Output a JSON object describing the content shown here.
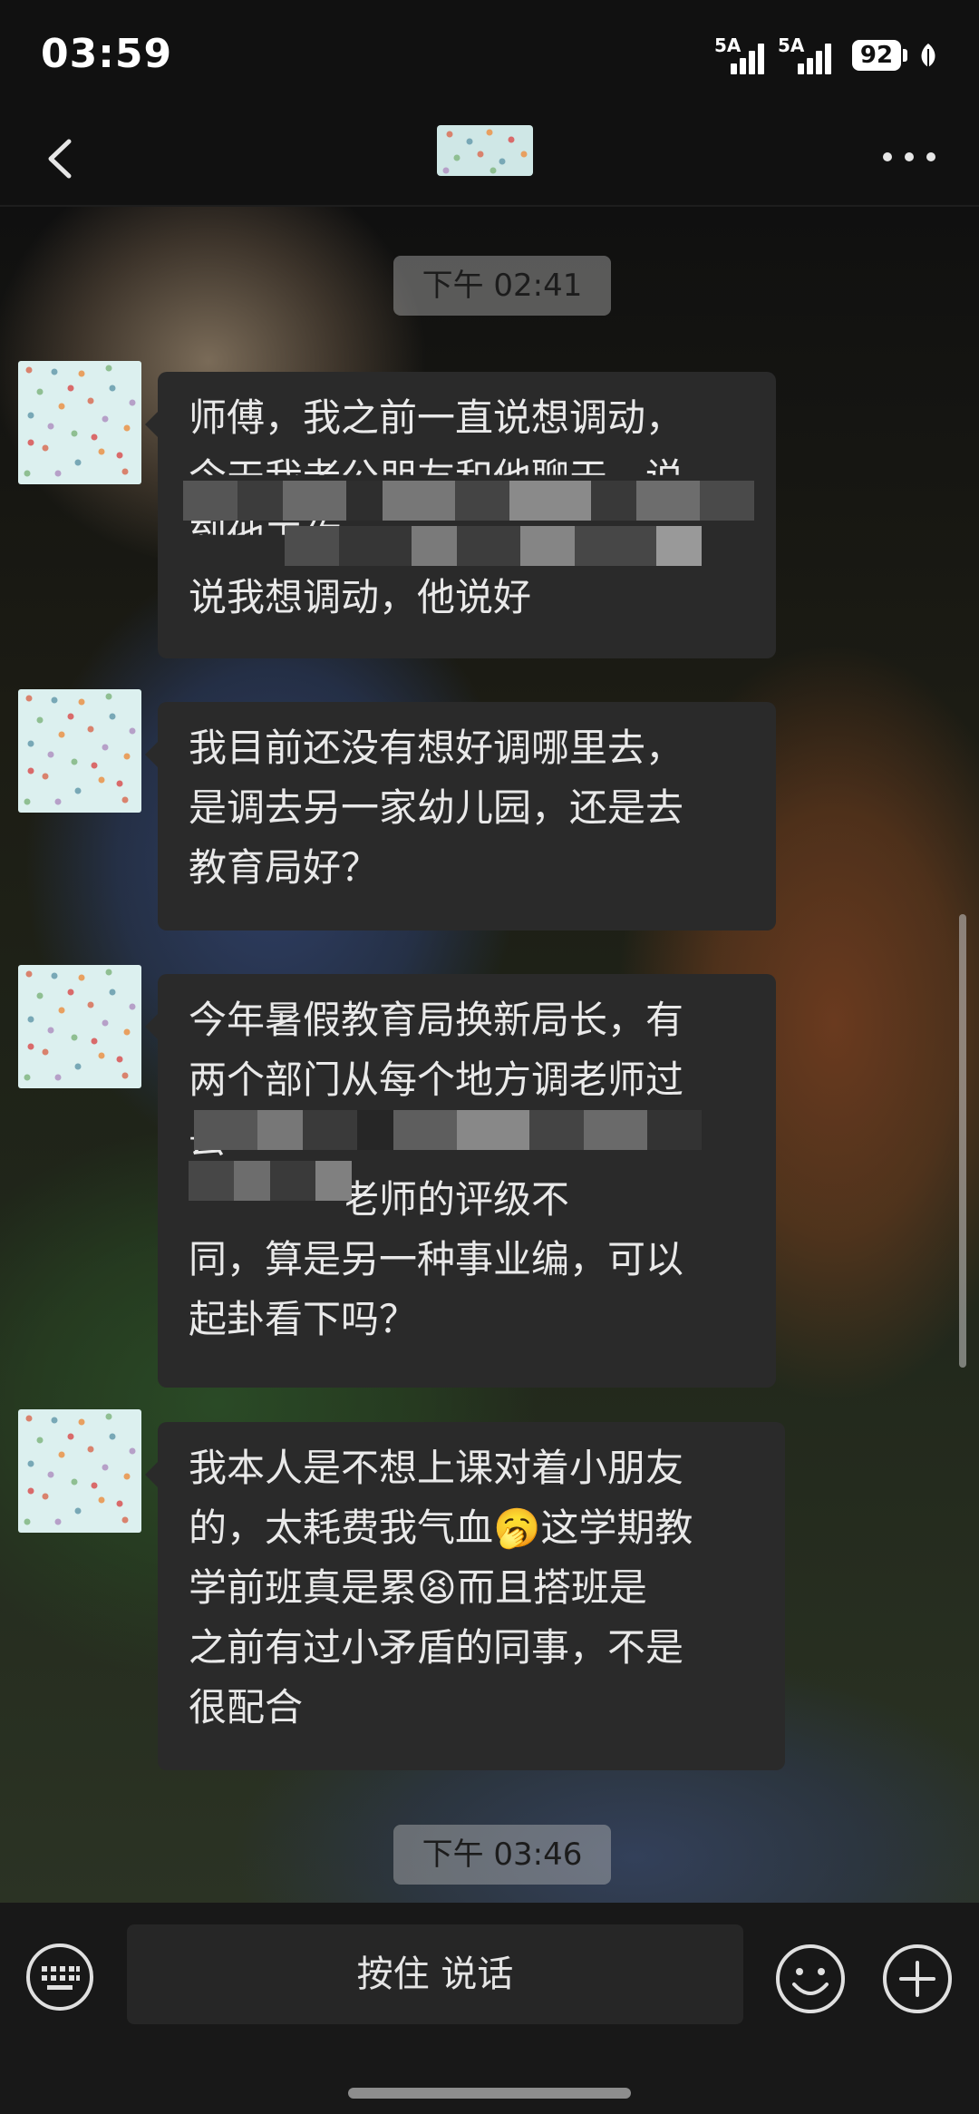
{
  "status_bar": {
    "time": "03:59",
    "signal_1": "5A",
    "signal_2": "5A",
    "battery": "92"
  },
  "nav": {
    "back_icon": "chevron-left-icon",
    "more_icon": "more-dots-icon"
  },
  "chat": {
    "timestamps": [
      "下午 02:41",
      "下午 03:46"
    ],
    "messages": [
      {
        "lines": [
          "师傅，我之前一直说想调动，",
          "今天我老公朋友和他聊天，说",
          "到他工作",
          "说我想调动，他说好"
        ]
      },
      {
        "lines": [
          "我目前还没有想好调哪里去，",
          "是调去另一家幼儿园，还是去",
          "教育局好？"
        ]
      },
      {
        "lines": [
          "今年暑假教育局换新局长，有",
          "两个部门从每个地方调老师过",
          "去",
          "一下过和老师的评级不",
          "同，算是另一种事业编，可以",
          "起卦看下吗？"
        ]
      },
      {
        "lines": [
          "我本人是不想上课对着小朋友",
          "的，太耗费我气血",
          "这学期教",
          "学前班真是累",
          "而且搭班是",
          "之前有过小矛盾的同事，不是",
          "很配合"
        ],
        "emoji_1": "🥱",
        "emoji_2": "😫"
      }
    ]
  },
  "input_bar": {
    "talk_label": "按住 说话",
    "keyboard_icon": "keyboard-icon",
    "emoji_icon": "emoji-icon",
    "plus_icon": "plus-icon"
  }
}
